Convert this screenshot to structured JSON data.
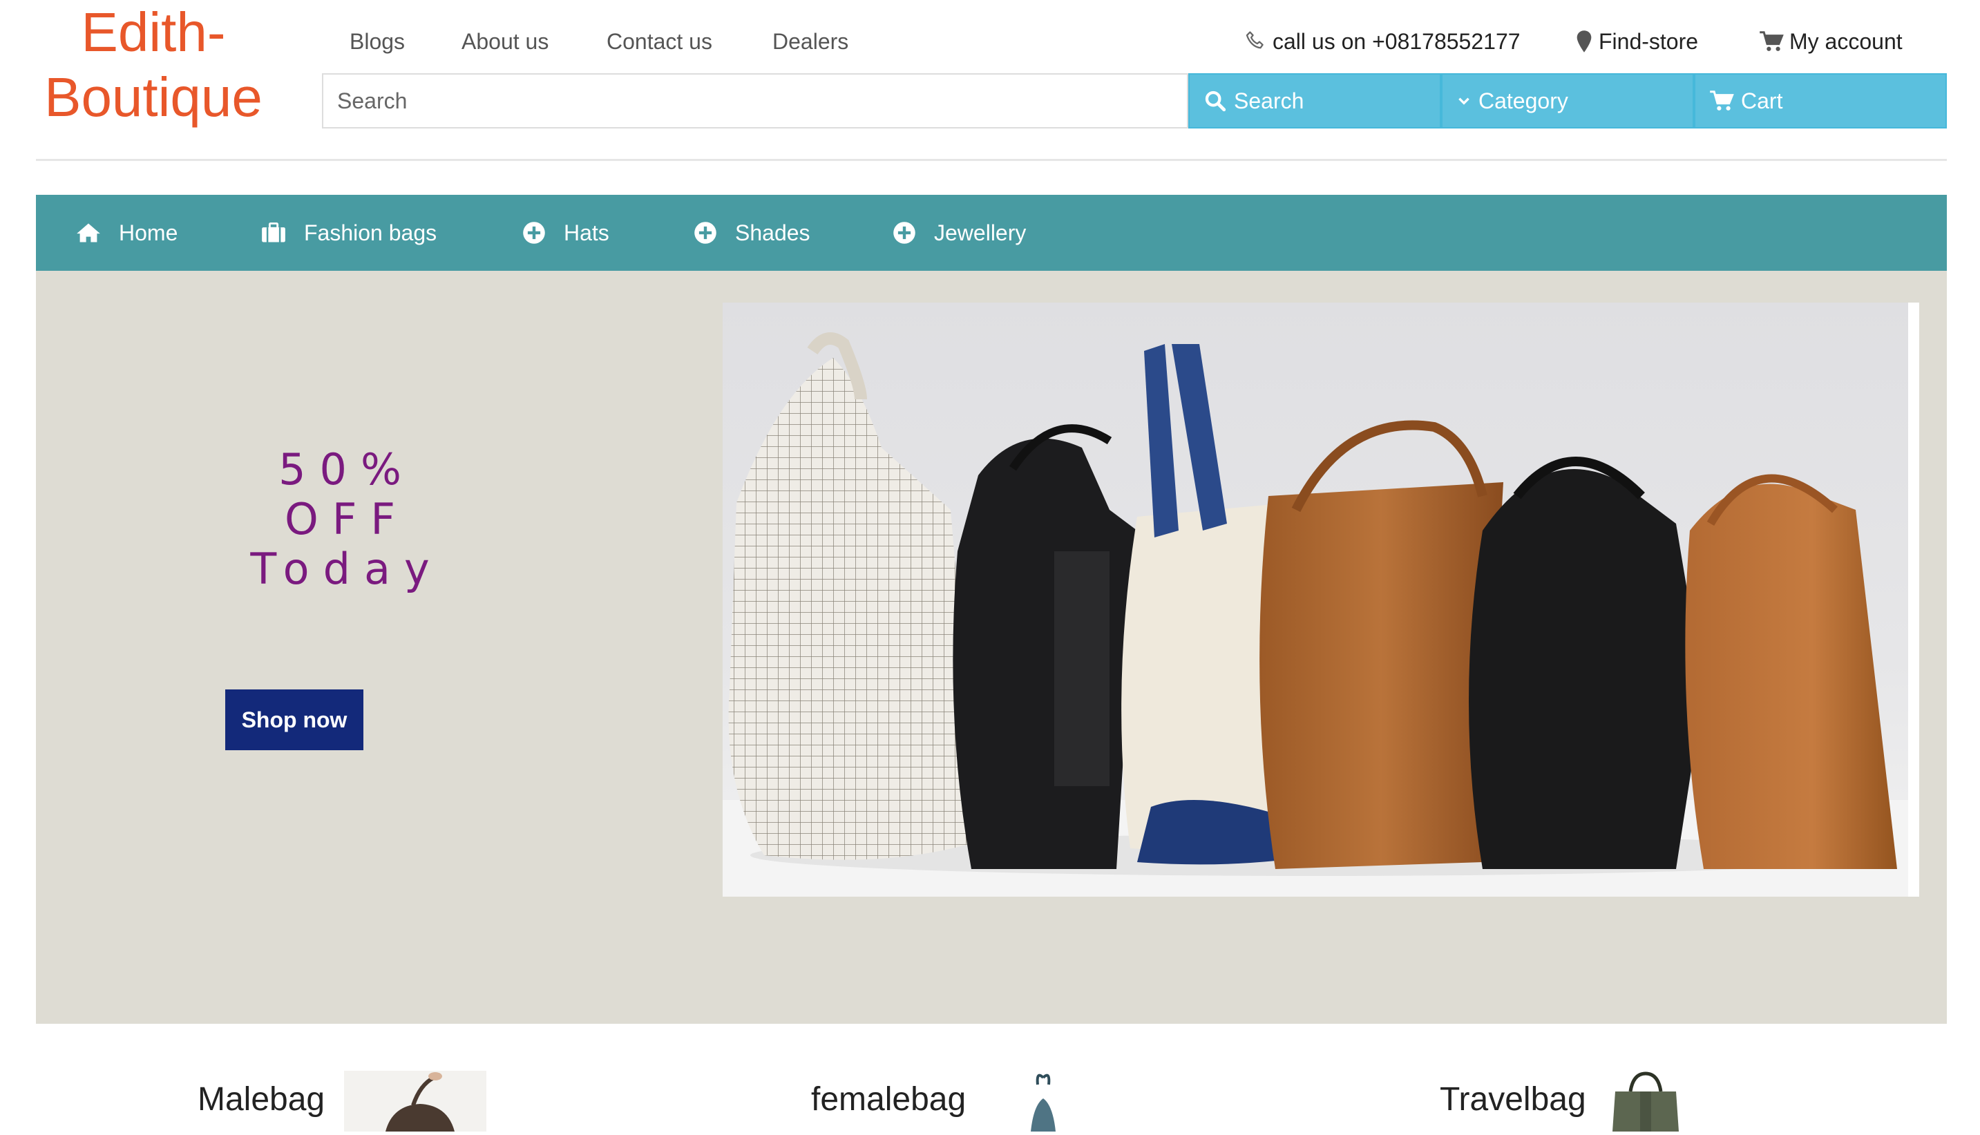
{
  "brand": {
    "line1": "Edith-",
    "line2": "Boutique",
    "color": "#e8572a"
  },
  "top_links": [
    "Blogs",
    "About us",
    "Contact us",
    "Dealers"
  ],
  "contact": {
    "phone_label": "call us on +08178552177",
    "find_store": "Find-store",
    "account": "My account"
  },
  "search": {
    "placeholder": "Search",
    "value": ""
  },
  "search_bar": {
    "search_button": "Search",
    "category_button": "Category",
    "cart_button": "Cart",
    "button_color": "#5bc0de"
  },
  "nav": {
    "color": "#489ba2",
    "items": [
      {
        "label": "Home",
        "icon": "home-icon"
      },
      {
        "label": "Fashion bags",
        "icon": "briefcase-icon"
      },
      {
        "label": "Hats",
        "icon": "plus-circle-icon"
      },
      {
        "label": "Shades",
        "icon": "plus-circle-icon"
      },
      {
        "label": "Jewellery",
        "icon": "plus-circle-icon"
      }
    ]
  },
  "hero": {
    "promo_line1": "50%",
    "promo_line2": "OFF",
    "promo_line3": "Today",
    "shop_button": "Shop now",
    "background": "#dedcd3",
    "promo_color": "#7a1a7f",
    "button_color": "#13297a"
  },
  "products": [
    {
      "name": "Malebag"
    },
    {
      "name": "femalebag"
    },
    {
      "name": "Travelbag"
    }
  ]
}
